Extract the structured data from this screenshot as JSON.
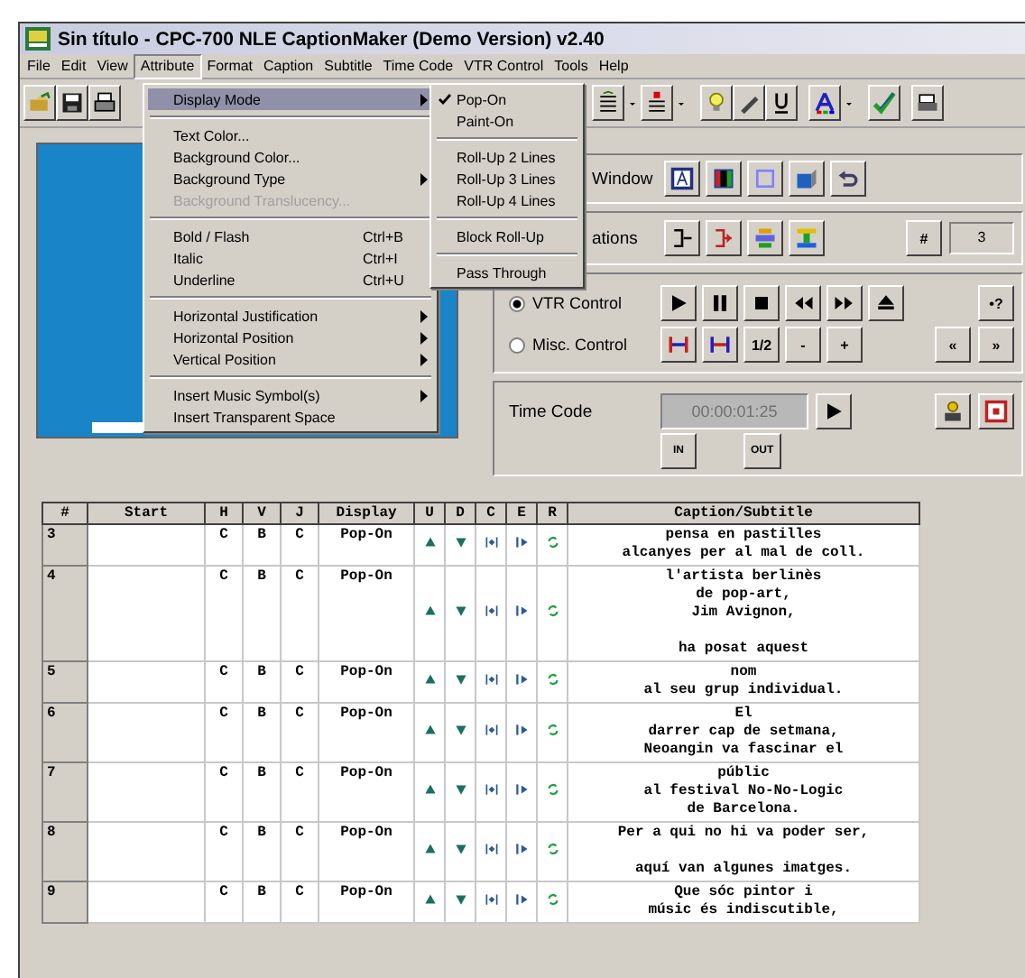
{
  "window": {
    "title": "Sin título - CPC-700 NLE CaptionMaker (Demo Version) v2.40"
  },
  "menu_bar": [
    {
      "label": "File",
      "selected": false
    },
    {
      "label": "Edit",
      "selected": false
    },
    {
      "label": "View",
      "selected": false
    },
    {
      "label": "Attribute",
      "selected": true
    },
    {
      "label": "Format",
      "selected": false
    },
    {
      "label": "Caption",
      "selected": false
    },
    {
      "label": "Subtitle",
      "selected": false
    },
    {
      "label": "Time Code",
      "selected": false
    },
    {
      "label": "VTR Control",
      "selected": false
    },
    {
      "label": "Tools",
      "selected": false
    },
    {
      "label": "Help",
      "selected": false
    }
  ],
  "attribute_menu": [
    {
      "kind": "item",
      "label": "Display Mode",
      "submenu": true,
      "selected": true,
      "disabled": false
    },
    {
      "kind": "separator"
    },
    {
      "kind": "item",
      "label": "Text Color...",
      "submenu": false,
      "selected": false,
      "disabled": false
    },
    {
      "kind": "item",
      "label": "Background Color...",
      "submenu": false,
      "selected": false,
      "disabled": false
    },
    {
      "kind": "item",
      "label": "Background Type",
      "submenu": true,
      "selected": false,
      "disabled": false
    },
    {
      "kind": "item",
      "label": "Background Translucency...",
      "submenu": false,
      "selected": false,
      "disabled": true
    },
    {
      "kind": "separator"
    },
    {
      "kind": "item",
      "label": "Bold / Flash",
      "shortcut": "Ctrl+B",
      "submenu": false,
      "selected": false,
      "disabled": false
    },
    {
      "kind": "item",
      "label": "Italic",
      "shortcut": "Ctrl+I",
      "submenu": false,
      "selected": false,
      "disabled": false
    },
    {
      "kind": "item",
      "label": "Underline",
      "shortcut": "Ctrl+U",
      "submenu": false,
      "selected": false,
      "disabled": false
    },
    {
      "kind": "separator"
    },
    {
      "kind": "item",
      "label": "Horizontal Justification",
      "submenu": true,
      "selected": false,
      "disabled": false
    },
    {
      "kind": "item",
      "label": "Horizontal Position",
      "submenu": true,
      "selected": false,
      "disabled": false
    },
    {
      "kind": "item",
      "label": "Vertical Position",
      "submenu": true,
      "selected": false,
      "disabled": false
    },
    {
      "kind": "separator"
    },
    {
      "kind": "item",
      "label": "Insert Music Symbol(s)",
      "submenu": true,
      "selected": false,
      "disabled": false
    },
    {
      "kind": "item",
      "label": "Insert Transparent Space",
      "submenu": false,
      "selected": false,
      "disabled": false
    }
  ],
  "display_mode_menu": [
    {
      "kind": "item",
      "label": "Pop-On",
      "checked": true
    },
    {
      "kind": "item",
      "label": "Paint-On",
      "checked": false
    },
    {
      "kind": "separator"
    },
    {
      "kind": "item",
      "label": "Roll-Up 2 Lines",
      "checked": false
    },
    {
      "kind": "item",
      "label": "Roll-Up 3 Lines",
      "checked": false
    },
    {
      "kind": "item",
      "label": "Roll-Up 4 Lines",
      "checked": false
    },
    {
      "kind": "separator"
    },
    {
      "kind": "item",
      "label": "Block Roll-Up",
      "checked": false
    },
    {
      "kind": "separator"
    },
    {
      "kind": "item",
      "label": "Pass Through",
      "checked": false
    }
  ],
  "window_panel": {
    "label": "Window"
  },
  "operations_panel": {
    "label": "ations",
    "number_button": "#",
    "count": "3"
  },
  "vtr_panel": {
    "modes": [
      {
        "label": "VTR Control",
        "selected": true
      },
      {
        "label": "Misc. Control",
        "selected": false
      }
    ],
    "help_button": "•?",
    "speed_button": "1/2",
    "minus_button": "-",
    "plus_button": "+",
    "back_button": "«",
    "forward_button": "»"
  },
  "time_code_panel": {
    "label": "Time Code",
    "value": "00:00:01:25",
    "in_button": "IN",
    "out_button": "OUT"
  },
  "table": {
    "columns": [
      "#",
      "Start",
      "H",
      "V",
      "J",
      "Display",
      "U",
      "D",
      "C",
      "E",
      "R",
      "Caption/Subtitle"
    ],
    "rows": [
      {
        "number": "3",
        "h": "C",
        "v": "B",
        "j": "C",
        "display": "Pop-On",
        "caption": "pensa en pastilles\nalcanyes per al mal de coll."
      },
      {
        "number": "4",
        "h": "C",
        "v": "B",
        "j": "C",
        "display": "Pop-On",
        "caption": "l'artista berlinès\nde pop-art,\nJim Avignon,\n\nha posat aquest"
      },
      {
        "number": "5",
        "h": "C",
        "v": "B",
        "j": "C",
        "display": "Pop-On",
        "caption": "nom\nal seu grup individual."
      },
      {
        "number": "6",
        "h": "C",
        "v": "B",
        "j": "C",
        "display": "Pop-On",
        "caption": "El\ndarrer cap de setmana,\nNeoangin va fascinar el"
      },
      {
        "number": "7",
        "h": "C",
        "v": "B",
        "j": "C",
        "display": "Pop-On",
        "caption": "públic\nal festival No-No-Logic\nde Barcelona."
      },
      {
        "number": "8",
        "h": "C",
        "v": "B",
        "j": "C",
        "display": "Pop-On",
        "caption": "Per a qui no hi va poder ser,\n\naquí van algunes imatges."
      },
      {
        "number": "9",
        "h": "C",
        "v": "B",
        "j": "C",
        "display": "Pop-On",
        "caption": "Que sóc pintor i\nmúsic és indiscutible,"
      }
    ]
  }
}
